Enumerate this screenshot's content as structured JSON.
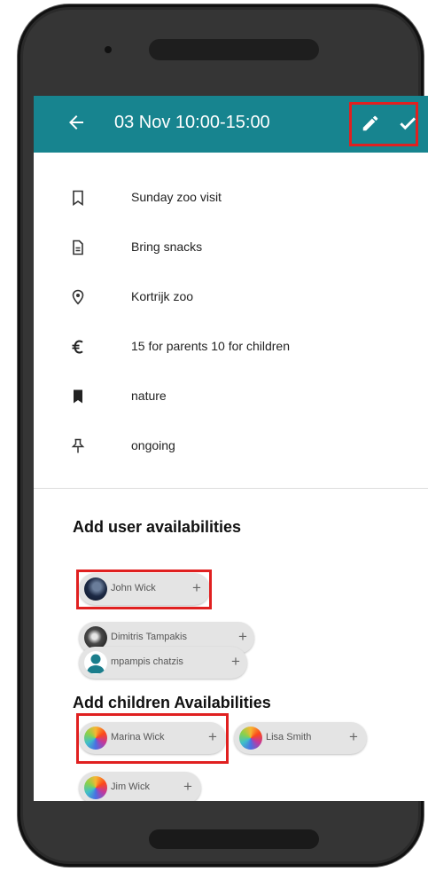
{
  "appbar": {
    "title": "03 Nov 10:00-15:00",
    "icons": {
      "back": "arrow-left-icon",
      "edit": "pencil-icon",
      "save": "check-icon"
    }
  },
  "event": {
    "title": "Sunday zoo visit",
    "description": "Bring snacks",
    "location": "Kortrijk zoo",
    "cost": "15 for parents 10 for children",
    "category": "nature",
    "status": "ongoing"
  },
  "users_section": {
    "title": "Add user availabilities",
    "users": [
      {
        "name": "John Wick",
        "avatar": "photo-avatar-dark"
      },
      {
        "name": "Dimitris Tampakis",
        "avatar": "photo-avatar-bw"
      },
      {
        "name": "mpampis chatzis",
        "avatar": "person-icon-teal"
      }
    ]
  },
  "children_section": {
    "title": "Add children Availabilities",
    "children": [
      {
        "name": "Marina Wick",
        "avatar": "gradient-avatar"
      },
      {
        "name": "Lisa Smith",
        "avatar": "gradient-avatar"
      },
      {
        "name": "Jim Wick",
        "avatar": "gradient-avatar"
      }
    ]
  },
  "chip_add_symbol": "+",
  "colors": {
    "appbar": "#17848f",
    "highlight": "#e02020",
    "chip": "#e4e4e4"
  }
}
